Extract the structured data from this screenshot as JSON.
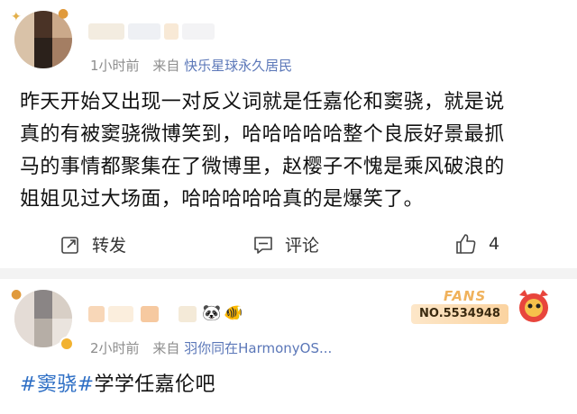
{
  "post1": {
    "meta_time": "1小时前",
    "meta_from": "来自",
    "meta_source": "快乐星球永久居民",
    "text": "昨天开始又出现一对反义词就是任嘉伦和窦骁，就是说真的有被窦骁微博笑到，哈哈哈哈哈整个良辰好景最抓马的事情都聚集在了微博里，赵樱子不愧是乘风破浪的姐姐见过大场面，哈哈哈哈哈真的是爆笑了。",
    "text_lines": [
      "昨天开始又出现一对反义词就是任嘉伦和窦骁，就是说",
      "真的有被窦骁微博笑到，哈哈哈哈哈整个良辰好景最抓",
      "马的事情都聚集在了微博里，赵樱子不愧是乘风破浪的",
      "姐姐见过大场面，哈哈哈哈哈真的是爆笑了。"
    ],
    "actions": {
      "repost_label": "转发",
      "comment_label": "评论",
      "like_count": "4"
    }
  },
  "post2": {
    "meta_time": "2小时前",
    "meta_from": "来自",
    "meta_source": "羽你同在HarmonyOS...",
    "fans_badge": {
      "word": "FANS",
      "number": "NO.5534948"
    },
    "hashtag": "#窦骁#",
    "text_rest": "学学任嘉伦吧"
  },
  "colors": {
    "link": "#2e6fc5",
    "source": "#5b77b8",
    "meta": "#8d8d8d",
    "divider": "#f3f3f3"
  },
  "icons": {
    "repost": "repost-icon",
    "comment": "comment-icon",
    "like": "thumbs-up-icon",
    "panda": "panda-emoji-icon",
    "fish": "goldfish-emoji-icon",
    "badge_mascot": "mascot-icon"
  }
}
